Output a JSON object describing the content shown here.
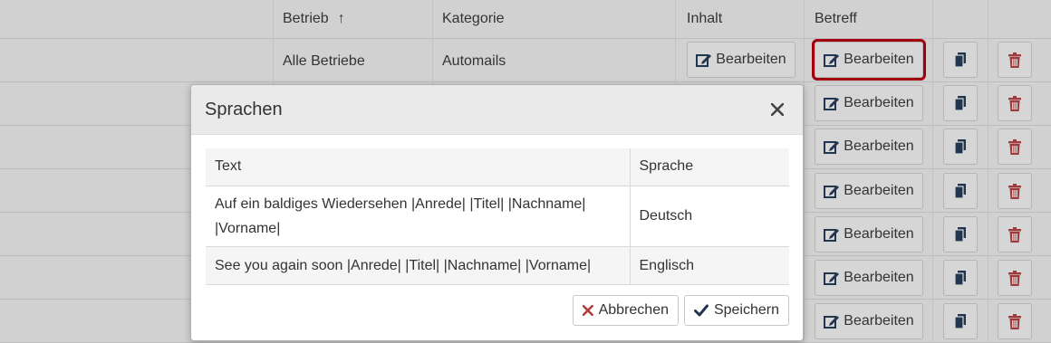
{
  "table": {
    "headers": {
      "betrieb": "Betrieb",
      "kategorie": "Kategorie",
      "inhalt": "Inhalt",
      "betreff": "Betreff"
    },
    "sort_indicator": "↑",
    "first_row": {
      "betrieb": "Alle Betriebe",
      "kategorie": "Automails"
    },
    "edit_label": "Bearbeiten"
  },
  "modal": {
    "title": "Sprachen",
    "close_glyph": "✕",
    "columns": {
      "text": "Text",
      "language": "Sprache"
    },
    "rows": [
      {
        "text": "Auf ein baldiges Wiedersehen |Anrede| |Titel| |Nachname| |Vorname|",
        "language": "Deutsch"
      },
      {
        "text": "See you again soon |Anrede| |Titel| |Nachname| |Vorname|",
        "language": "Englisch"
      }
    ],
    "cancel_label": "Abbrechen",
    "save_label": "Speichern"
  },
  "colors": {
    "edit_icon": "#1f3550",
    "delete_icon": "#a33a3a",
    "highlight": "#a3000f",
    "cancel_icon": "#b33a3a",
    "save_icon": "#1f3550"
  }
}
